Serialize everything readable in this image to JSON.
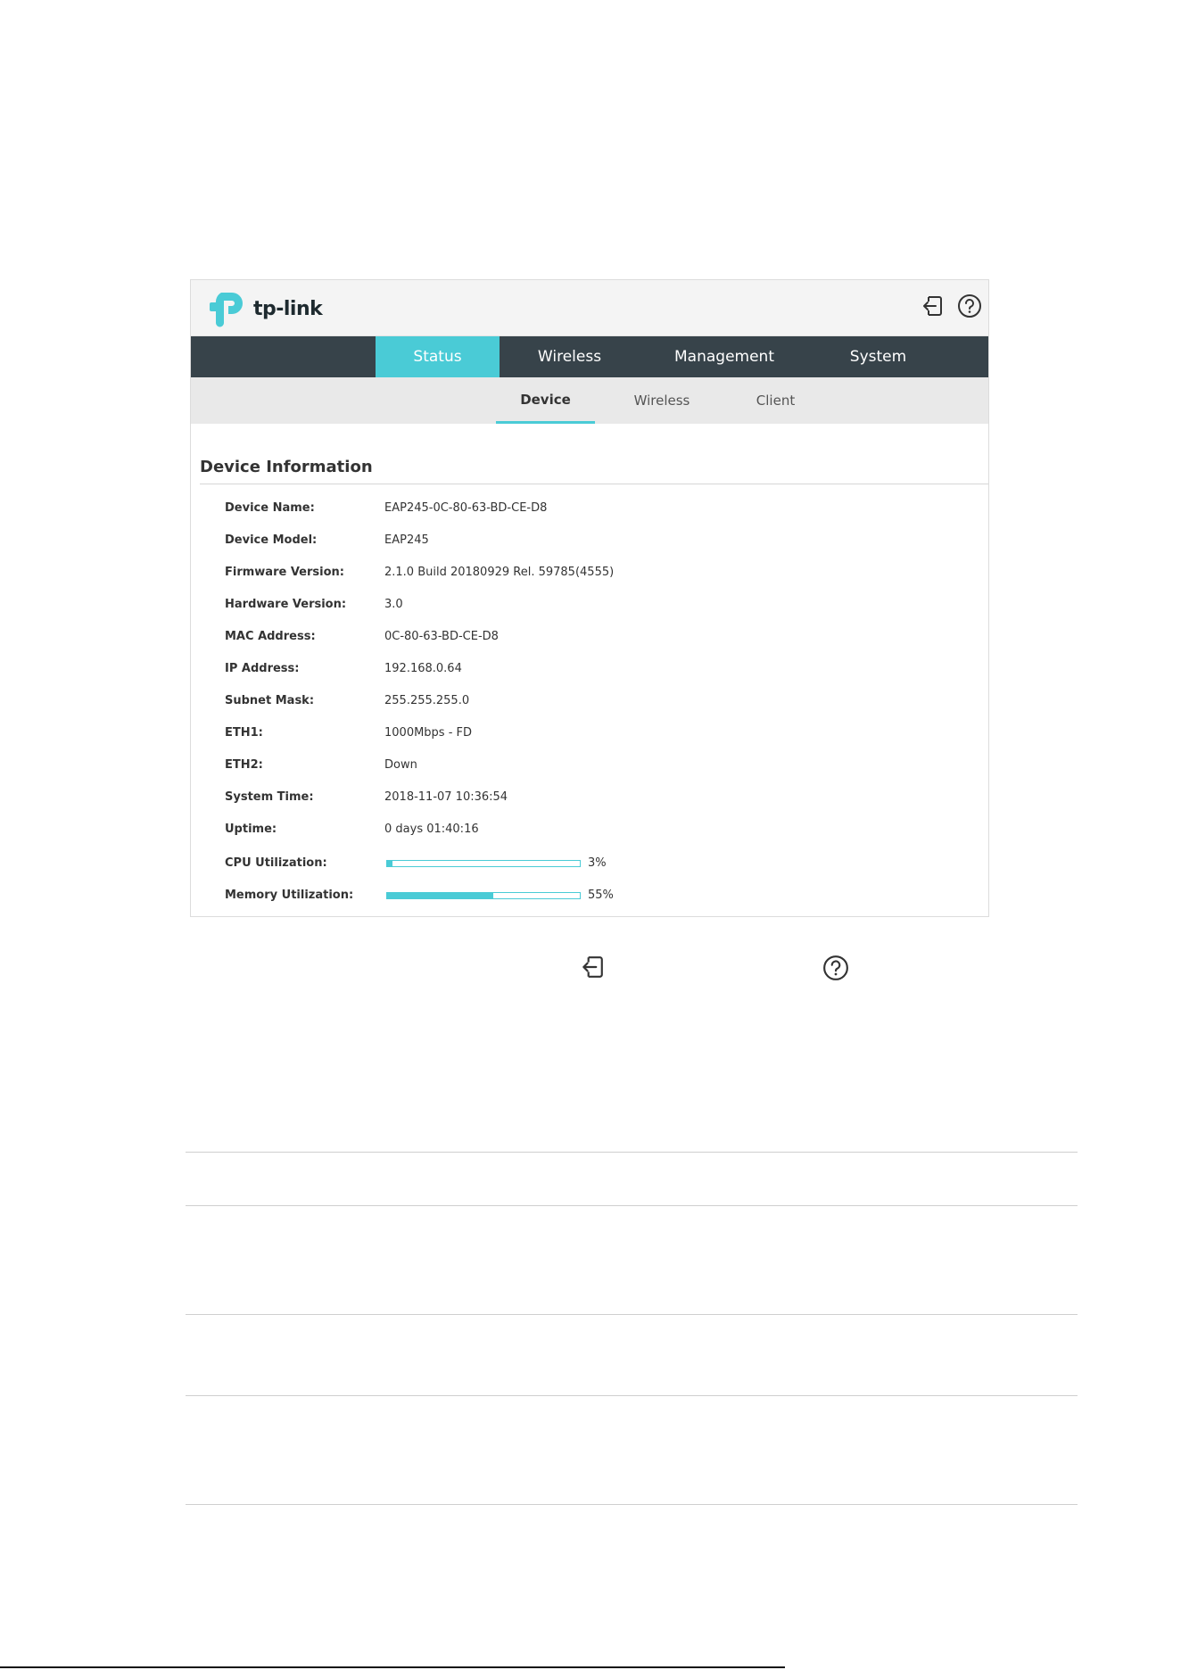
{
  "brand": {
    "logo_text": "tp-link",
    "accent_color": "#4acbd6",
    "nav_color": "#37434a"
  },
  "header_icons": {
    "logout": "logout-icon",
    "help": "help-icon"
  },
  "nav": {
    "tabs": [
      {
        "label": "Status",
        "active": true
      },
      {
        "label": "Wireless",
        "active": false
      },
      {
        "label": "Management",
        "active": false
      },
      {
        "label": "System",
        "active": false
      }
    ]
  },
  "subnav": {
    "tabs": [
      {
        "label": "Device",
        "active": true
      },
      {
        "label": "Wireless",
        "active": false
      },
      {
        "label": "Client",
        "active": false
      }
    ]
  },
  "device_info": {
    "title": "Device Information",
    "rows": [
      {
        "label": "Device Name:",
        "value": "EAP245-0C-80-63-BD-CE-D8"
      },
      {
        "label": "Device Model:",
        "value": "EAP245"
      },
      {
        "label": "Firmware Version:",
        "value": "2.1.0 Build 20180929 Rel. 59785(4555)"
      },
      {
        "label": "Hardware Version:",
        "value": "3.0"
      },
      {
        "label": "MAC Address:",
        "value": "0C-80-63-BD-CE-D8"
      },
      {
        "label": "IP Address:",
        "value": "192.168.0.64"
      },
      {
        "label": "Subnet Mask:",
        "value": "255.255.255.0"
      },
      {
        "label": "ETH1:",
        "value": "1000Mbps - FD"
      },
      {
        "label": "ETH2:",
        "value": "Down"
      },
      {
        "label": "System Time:",
        "value": "2018-11-07 10:36:54"
      },
      {
        "label": "Uptime:",
        "value": "0 days 01:40:16"
      }
    ],
    "cpu": {
      "label": "CPU Utilization:",
      "percent": 3,
      "text": "3%"
    },
    "memory": {
      "label": "Memory Utilization:",
      "percent": 55,
      "text": "55%"
    }
  }
}
